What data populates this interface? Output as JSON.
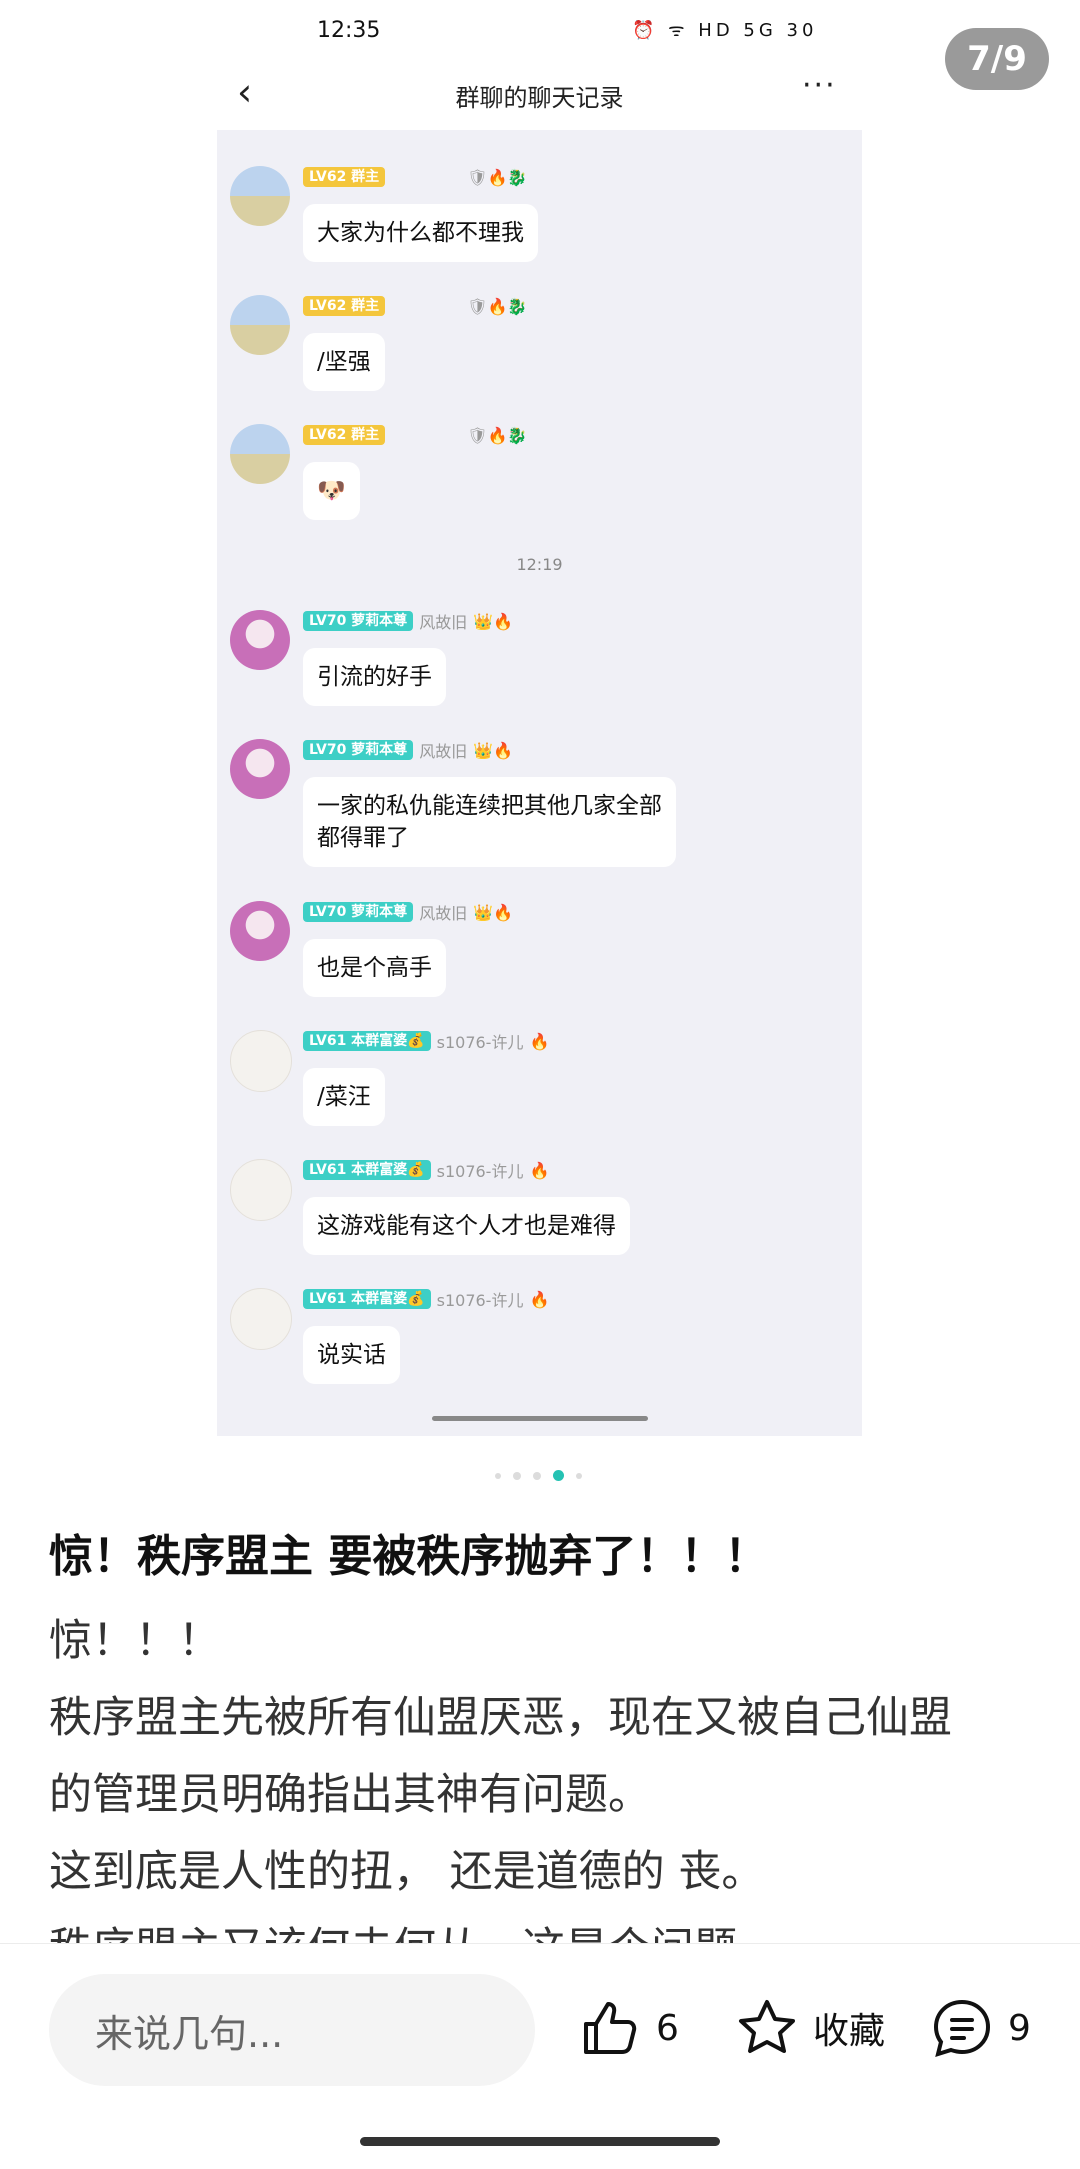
{
  "page_counter": "7/9",
  "screenshot": {
    "status_time": "12:35",
    "status_icons": "⏰ ᯤ HD 5G 30",
    "back_icon": "‹",
    "title": "群聊的聊天记录",
    "more_icon": "···",
    "time_divider": "12:19",
    "messages": [
      {
        "level_tag": "LV62 群主",
        "name": "",
        "text": "大家为什么都不理我"
      },
      {
        "level_tag": "LV62 群主",
        "name": "",
        "text": "/坚强"
      },
      {
        "level_tag": "LV62 群主",
        "name": "",
        "text": "🐶"
      },
      {
        "level_tag": "LV70 萝莉本尊",
        "name": "风故旧",
        "text": "引流的好手"
      },
      {
        "level_tag": "LV70 萝莉本尊",
        "name": "风故旧",
        "text": "一家的私仇能连续把其他几家全部"
      },
      {
        "level_tag": "LV70 萝莉本尊",
        "name": "风故旧",
        "text": "也是个高手"
      },
      {
        "level_tag": "LV61 本群富婆💰",
        "name": "s1076-许儿",
        "text": "/菜汪"
      },
      {
        "level_tag": "LV61 本群富婆💰",
        "name": "s1076-许儿",
        "text": "这游戏能有这个人才也是难得"
      },
      {
        "level_tag": "LV61 本群富婆💰",
        "name": "s1076-许儿",
        "text": "说实话"
      }
    ],
    "message_5_line2": "都得罪了"
  },
  "post": {
    "title": "惊！秩序盟主 要被秩序抛弃了！！！",
    "lines": [
      "惊！！！",
      "秩序盟主先被所有仙盟厌恶，现在又被自己仙盟",
      "的管理员明确指出其神有问题。",
      "这到底是人性的扭， 还是道德的 丧。",
      "秩序盟主又该何去何从，这是个问题"
    ]
  },
  "bottom_bar": {
    "comment_placeholder": "来说几句...",
    "like_count": "6",
    "favorite_label": "收藏",
    "comment_count": "9"
  },
  "colors": {
    "accent_teal": "#25c2b3",
    "tag_gold": "#f4c63c",
    "tag_teal": "#3dcfc6",
    "chat_bg": "#f0f0f6"
  }
}
